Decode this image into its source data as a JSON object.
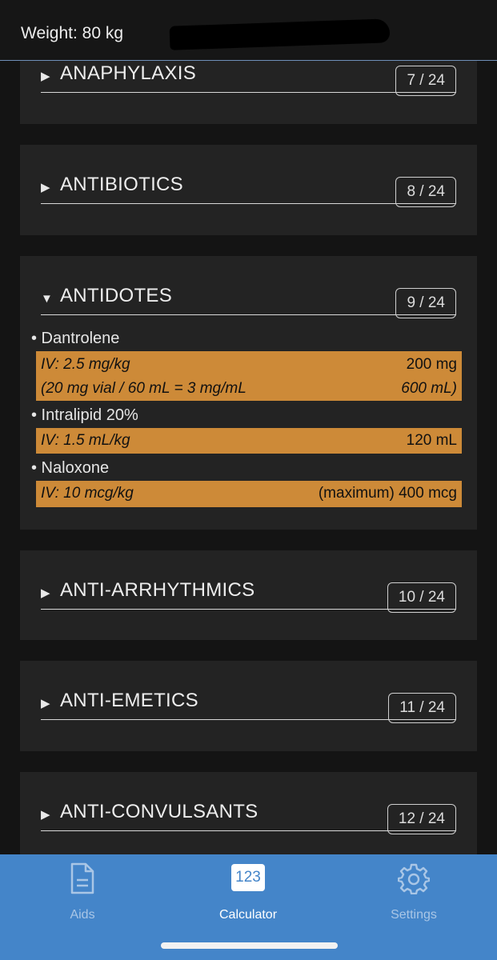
{
  "header": {
    "weight_label": "Weight: 80 kg"
  },
  "categories": [
    {
      "name": "ANAPHYLAXIS",
      "badge": "7 / 24",
      "expanded": false
    },
    {
      "name": "ANTIBIOTICS",
      "badge": "8 / 24",
      "expanded": false
    },
    {
      "name": "ANTIDOTES",
      "badge": "9 / 24",
      "expanded": true
    },
    {
      "name": "ANTI-ARRHYTHMICS",
      "badge": "10 / 24",
      "expanded": false
    },
    {
      "name": "ANTI-EMETICS",
      "badge": "11 / 24",
      "expanded": false
    },
    {
      "name": "ANTI-CONVULSANTS",
      "badge": "12 / 24",
      "expanded": false
    }
  ],
  "antidotes": [
    {
      "name": "• Dantrolene",
      "rows": [
        {
          "left": "IV: 2.5 mg/kg",
          "right": "200 mg"
        },
        {
          "left": "(20 mg vial / 60 mL = 3 mg/mL",
          "right": "600 mL)"
        }
      ]
    },
    {
      "name": "• Intralipid 20%",
      "rows": [
        {
          "left": "IV: 1.5 mL/kg",
          "right": "120 mL"
        }
      ]
    },
    {
      "name": "• Naloxone",
      "rows": [
        {
          "left": "IV: 10 mcg/kg",
          "right": "(maximum) 400 mcg"
        }
      ]
    }
  ],
  "tabbar": {
    "tabs": [
      {
        "label": "Aids",
        "icon": "document-icon",
        "active": false
      },
      {
        "label": "Calculator",
        "icon": "calculator-123-icon",
        "active": true,
        "icon_text": "123"
      },
      {
        "label": "Settings",
        "icon": "gear-icon",
        "active": false
      }
    ]
  },
  "colors": {
    "accent_tab": "#4485c9",
    "dose_highlight": "#cd8a38",
    "card_bg": "#232323"
  }
}
